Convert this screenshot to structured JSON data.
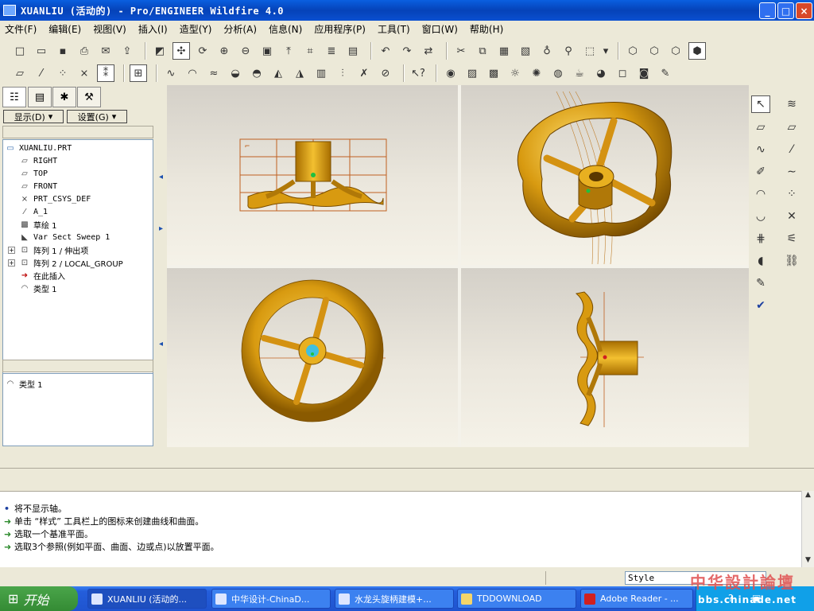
{
  "window": {
    "title": "XUANLIU (活动的) - Pro/ENGINEER Wildfire 4.0",
    "buttons": {
      "minimize": "_",
      "maximize": "□",
      "close": "×"
    }
  },
  "menu": [
    "文件(F)",
    "编辑(E)",
    "视图(V)",
    "插入(I)",
    "造型(Y)",
    "分析(A)",
    "信息(N)",
    "应用程序(P)",
    "工具(T)",
    "窗口(W)",
    "帮助(H)"
  ],
  "panel": {
    "show_label": "显示(D)",
    "settings_label": "设置(G)",
    "tree": [
      {
        "label": "XUANLIU.PRT",
        "icon": "part-icon"
      },
      {
        "label": "RIGHT",
        "icon": "datum-plane-icon"
      },
      {
        "label": "TOP",
        "icon": "datum-plane-icon"
      },
      {
        "label": "FRONT",
        "icon": "datum-plane-icon"
      },
      {
        "label": "PRT_CSYS_DEF",
        "icon": "csys-icon"
      },
      {
        "label": "A_1",
        "icon": "axis-icon"
      },
      {
        "label": "草绘 1",
        "icon": "sketch-icon"
      },
      {
        "label": "Var Sect Sweep 1",
        "icon": "sweep-icon"
      },
      {
        "label": "阵列 1 / 伸出项",
        "icon": "pattern-icon"
      },
      {
        "label": "阵列 2 / LOCAL_GROUP",
        "icon": "pattern-icon"
      },
      {
        "label": "在此插入",
        "icon": "insert-arrow-icon"
      },
      {
        "label": "类型 1",
        "icon": "style-feature-icon"
      }
    ],
    "sub_item": "类型 1"
  },
  "messages": [
    "将不显示轴。",
    "单击 “样式” 工具栏上的图标来创建曲线和曲面。",
    "选取一个基准平面。",
    "选取3个参照(例如平面、曲面、边或点)以放置平面。"
  ],
  "status": {
    "style_field": "Style"
  },
  "taskbar": {
    "start": "开始",
    "tasks": [
      "XUANLIU (活动的...",
      "中华设计-ChinaD...",
      "水龙头旋柄建模+...",
      "TDDOWNLOAD",
      "Adobe Reader - ..."
    ]
  },
  "watermark": {
    "line1": "中华設計論壇",
    "line2": "bbs.chinade.net"
  },
  "colors": {
    "model": "#d89a10",
    "model_dark": "#8a5a00",
    "title_bar": "#0542b8"
  }
}
